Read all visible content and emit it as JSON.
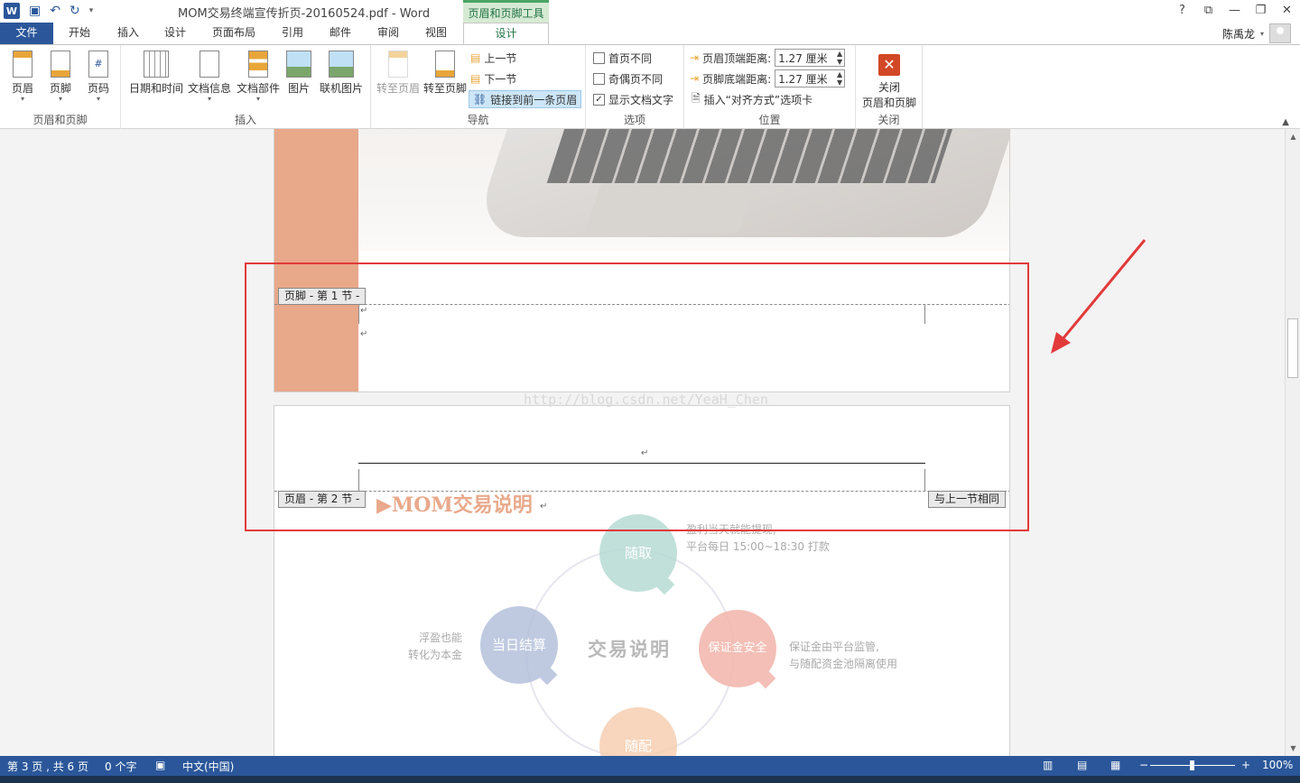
{
  "app": {
    "doc_title": "MOM交易终端宣传折页-20160524.pdf - Word",
    "context_tab_title": "页眉和页脚工具",
    "window_controls": [
      "?",
      "⧉",
      "—",
      "❐",
      "✕"
    ],
    "user_name": "陈禹龙"
  },
  "tabs": [
    "文件",
    "开始",
    "插入",
    "设计",
    "页面布局",
    "引用",
    "邮件",
    "审阅",
    "视图",
    "设计"
  ],
  "ribbon": {
    "groups": {
      "header_footer": {
        "label": "页眉和页脚",
        "buttons": [
          "页眉",
          "页脚",
          "页码"
        ]
      },
      "insert": {
        "label": "插入",
        "buttons": [
          "日期和时间",
          "文档信息",
          "文档部件",
          "图片",
          "联机图片"
        ]
      },
      "navigation": {
        "label": "导航",
        "buttons": [
          "转至页眉",
          "转至页脚"
        ],
        "links": [
          "上一节",
          "下一节",
          "链接到前一条页眉"
        ]
      },
      "options": {
        "label": "选项",
        "items": [
          {
            "label": "首页不同",
            "checked": false
          },
          {
            "label": "奇偶页不同",
            "checked": false
          },
          {
            "label": "显示文档文字",
            "checked": true
          }
        ]
      },
      "position": {
        "label": "位置",
        "header_distance_label": "页眉顶端距离:",
        "header_distance_value": "1.27 厘米",
        "footer_distance_label": "页脚底端距离:",
        "footer_distance_value": "1.27 厘米",
        "align_tab": "插入“对齐方式”选项卡"
      },
      "close": {
        "label": "关闭",
        "button_line1": "关闭",
        "button_line2": "页眉和页脚"
      }
    }
  },
  "document": {
    "footer_tag": "页脚 - 第 1 节 -",
    "header_tag": "页眉 - 第 2 节 -",
    "same_as_prev": "与上一节相同",
    "mom_title": "▶MOM交易说明",
    "paragraph_mark": "↵",
    "watermark": "http://blog.csdn.net/YeaH_Chen",
    "infographic": {
      "center": "交易说明",
      "bubbles": [
        {
          "label": "随取",
          "color": "#b7dbd4"
        },
        {
          "label": "当日结算",
          "color": "#b4c1dc"
        },
        {
          "label": "保证金安全",
          "color": "#f2b5aa"
        },
        {
          "label": "随配",
          "color": "#f6cfb2"
        }
      ],
      "notes": {
        "top_line1": "盈利当天就能提现,",
        "top_line2": "平台每日 15:00~18:30 打款",
        "left_line1": "浮盈也能",
        "left_line2": "转化为本金",
        "right_line1": "保证金由平台监管,",
        "right_line2": "与随配资金池隔离使用"
      }
    }
  },
  "status": {
    "page": "第 3 页 , 共 6 页",
    "words": "0 个字",
    "lang": "中文(中国)",
    "zoom_minus": "−",
    "zoom_plus": "+",
    "zoom_value": "100%"
  },
  "colors": {
    "word_blue": "#2b579a",
    "context_green": "#217346",
    "annotation_red": "#e23a3a",
    "stripe_peach": "#e8a88a"
  }
}
